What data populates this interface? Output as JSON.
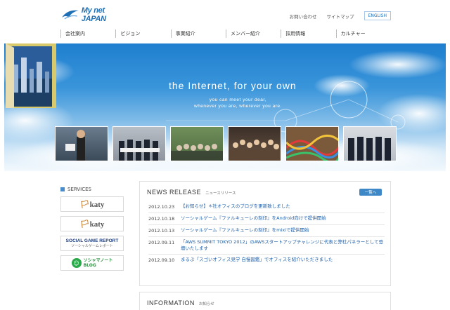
{
  "header": {
    "logo_text": "My net JAPAN",
    "util_links": [
      "お問い合わせ",
      "サイトマップ",
      "ENGLISH"
    ],
    "nav": [
      "会社案内",
      "ビジョン",
      "事業紹介",
      "メンバー紹介",
      "採用情報",
      "カルチャー"
    ]
  },
  "hero": {
    "tagline": "the Internet, for your own",
    "sub_line1": "you can meet your dear,",
    "sub_line2": "whenever you are, wherever you are."
  },
  "services": {
    "title": "SERVICES",
    "katy1": "katy",
    "katy2": "katy",
    "sgr_title": "SOCIAL GAME REPORT",
    "sgr_sub": "ソーシャルゲームレポート",
    "blog_title": "ソシャマノート",
    "blog_sub": "BLOG"
  },
  "news": {
    "title": "NEWS RELEASE",
    "subtitle": "ニュースリリース",
    "more_label": "一覧へ",
    "items": [
      {
        "date": "2012.10.23",
        "title": "【お知らせ】＊社オフィスのブログを更新致しました"
      },
      {
        "date": "2012.10.18",
        "title": "ソーシャルゲーム『ファルキューレの刻印』をAndroid向けで提供開始"
      },
      {
        "date": "2012.10.13",
        "title": "ソーシャルゲーム『ファルキューレの刻印』をmixiで提供開始"
      },
      {
        "date": "2012.09.11",
        "title": "「AWS SUMMIT TOKYO 2012」のAWSスタートアップチャレンジに代表と弊社パネラーとして登壇いたします"
      },
      {
        "date": "2012.09.10",
        "title": "まるぶ「スゴいオフィス見学 自慢図鑑」でオフィスを紹介いただきました"
      }
    ]
  },
  "info": {
    "title": "INFORMATION",
    "subtitle": "お知らせ"
  }
}
